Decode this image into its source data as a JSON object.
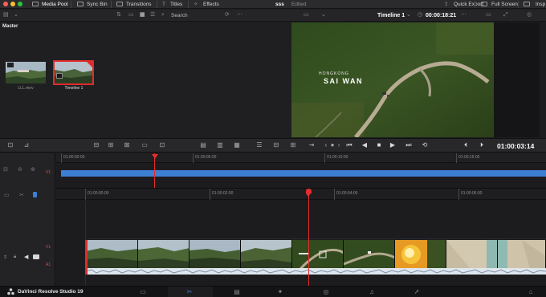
{
  "topbar": {
    "media_pool": "Media Pool",
    "sync_bin": "Sync Bin",
    "transitions": "Transitions",
    "titles": "Titles",
    "effects": "Effects",
    "project_name": "sss",
    "project_status": "Edited",
    "quick_export": "Quick Export",
    "full_screen": "Full Screen",
    "inspector": "Insp"
  },
  "subbar": {
    "search_label": "Search",
    "timeline_name": "Timeline 1",
    "timecode": "00:00:18:21"
  },
  "media_pool": {
    "bin_name": "Master",
    "items": [
      {
        "label": "LLL.mov",
        "icon": "video-clip-icon"
      },
      {
        "label": "Timeline 1",
        "icon": "timeline-icon"
      }
    ]
  },
  "viewer": {
    "title_line1": "HONGKONG",
    "title_line2": "SAI WAN",
    "current_timecode": "01:00:03:14"
  },
  "upper_timeline": {
    "track_label": "V1",
    "ruler": [
      "01:00:00:00",
      "01:00:05:00",
      "01:00:10:00",
      "01:00:15:00"
    ]
  },
  "lower_timeline": {
    "ruler": [
      "01:00:00:00",
      "01:00:02:00",
      "01:00:04:00",
      "01:00:06:00"
    ],
    "video_track": "V1",
    "audio_track": "A1"
  },
  "bottombar": {
    "app_name": "DaVinci Resolve Studio 19"
  },
  "colors": {
    "accent_blue": "#3d7fd2",
    "playhead_red": "#e52d2d",
    "selection_red": "#e22b2b"
  }
}
